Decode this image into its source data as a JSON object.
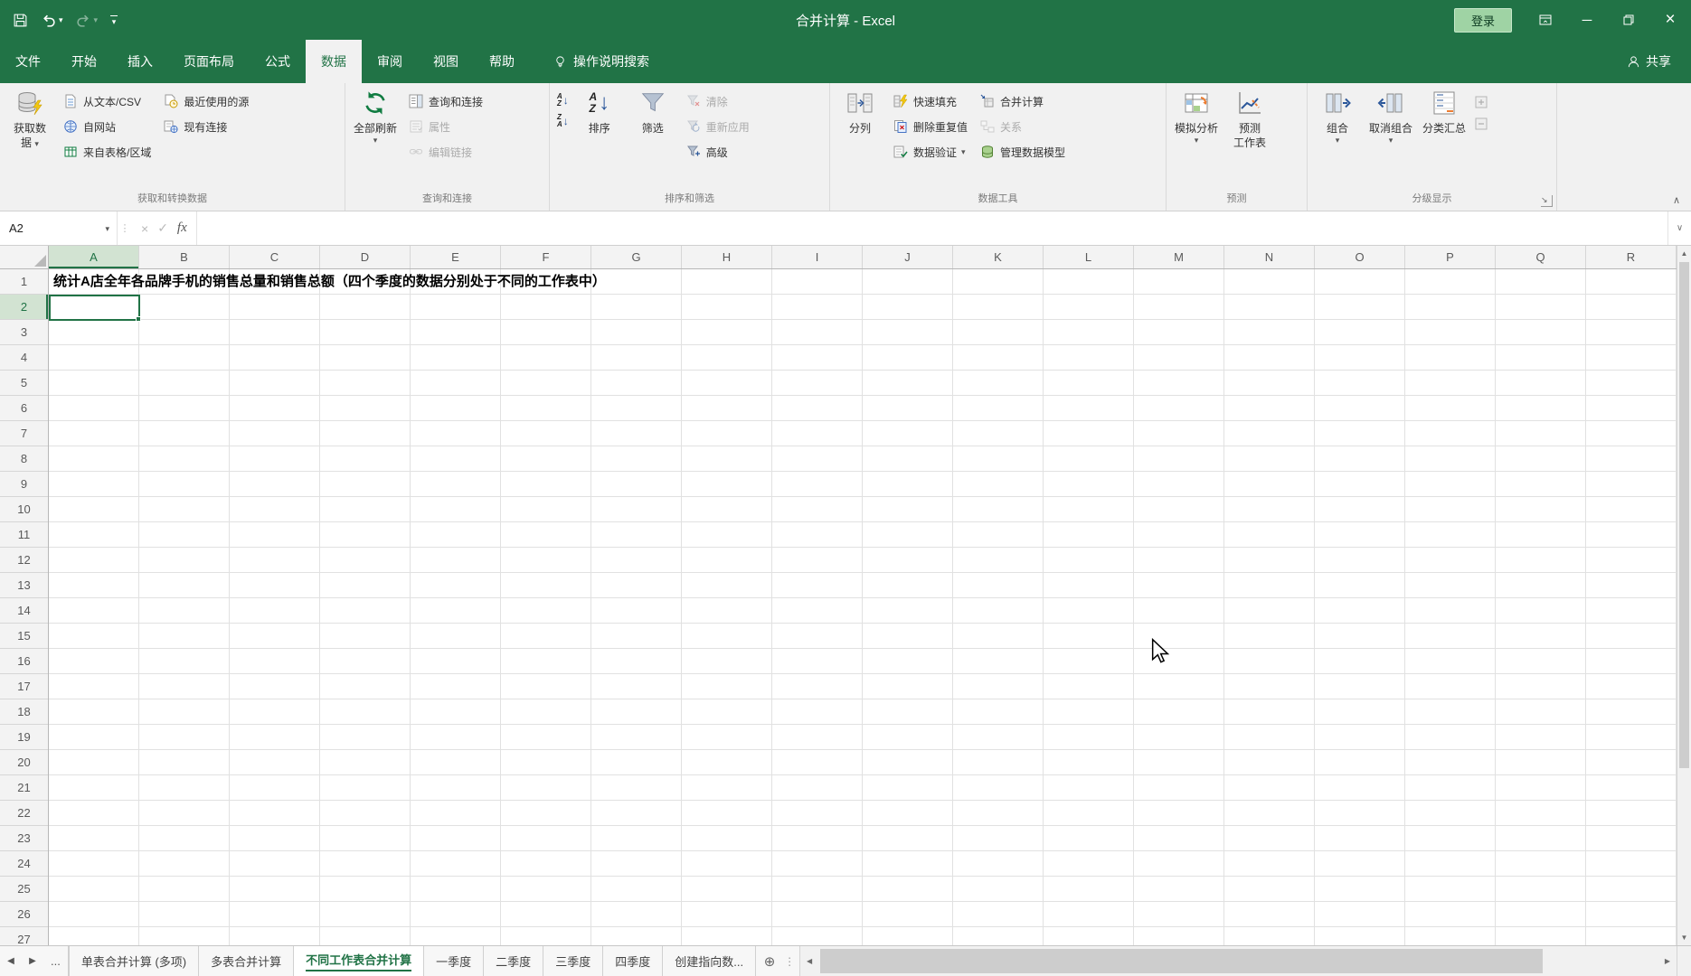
{
  "theme": {
    "titlebar_green": "#217346",
    "accent_green": "#217346",
    "ribbon_bg": "#f1f1f1",
    "header_bg": "#f3f3f3",
    "active_header_bg": "#d2e3d2",
    "grid_line": "#e1e1e1",
    "disabled_text": "#ababab",
    "signin_bg": "#9fd3a4"
  },
  "glyphs": {
    "dropdown": "▾",
    "collapse": "∧",
    "expand": "∨",
    "up": "▲",
    "down": "▼",
    "left": "◀",
    "right": "▶",
    "arrow_down": "↓",
    "letter_a": "A",
    "letter_z": "Z",
    "add_sheet": "⊕",
    "grip": "⋮",
    "ellipsis": "...",
    "cancel": "×",
    "check": "✓",
    "launcher": "↘",
    "minimize": "─",
    "close": "×",
    "plus": "+",
    "minus": "−"
  },
  "titlebar": {
    "title": "合并计算 - Excel",
    "signin": "登录"
  },
  "tabs": {
    "file": "文件",
    "items": [
      "开始",
      "插入",
      "页面布局",
      "公式",
      "数据",
      "审阅",
      "视图",
      "帮助"
    ],
    "active": "数据",
    "search": "操作说明搜索",
    "share": "共享"
  },
  "ribbon": {
    "groups": [
      {
        "label": "获取和转换数据",
        "get_data_lines": [
          "获取数",
          "据"
        ],
        "from_text_csv": "从文本/CSV",
        "from_web": "自网站",
        "from_table": "来自表格/区域",
        "recent_sources": "最近使用的源",
        "existing_connections": "现有连接"
      },
      {
        "label": "查询和连接",
        "refresh_all": "全部刷新",
        "queries_connections": "查询和连接",
        "properties": "属性",
        "edit_links": "编辑链接"
      },
      {
        "label": "排序和筛选",
        "sort": "排序",
        "filter": "筛选",
        "clear": "清除",
        "reapply": "重新应用",
        "advanced": "高级"
      },
      {
        "label": "数据工具",
        "text_to_columns": "分列",
        "flash_fill": "快速填充",
        "remove_duplicates": "删除重复值",
        "data_validation": "数据验证",
        "consolidate": "合并计算",
        "relationships": "关系",
        "manage_data_model": "管理数据模型"
      },
      {
        "label": "预测",
        "what_if": "模拟分析",
        "forecast_lines": [
          "预测",
          "工作表"
        ]
      },
      {
        "label": "分级显示",
        "group": "组合",
        "ungroup": "取消组合",
        "subtotal": "分类汇总"
      }
    ]
  },
  "formula_bar": {
    "name_box": "A2",
    "fx": "fx",
    "value": ""
  },
  "grid": {
    "columns": [
      "A",
      "B",
      "C",
      "D",
      "E",
      "F",
      "G",
      "H",
      "I",
      "J",
      "K",
      "L",
      "M",
      "N",
      "O",
      "P",
      "Q",
      "R"
    ],
    "visible_rows": 27,
    "active_cell": {
      "col": "A",
      "row": 2,
      "ref": "A2"
    },
    "cells": {
      "A1": "统计A店全年各品牌手机的销售总量和销售总额（四个季度的数据分别处于不同的工作表中）"
    }
  },
  "sheet_tabs": {
    "tabs": [
      "单表合并计算 (多项)",
      "多表合并计算",
      "不同工作表合并计算",
      "一季度",
      "二季度",
      "三季度",
      "四季度",
      "创建指向数..."
    ],
    "active": "不同工作表合并计算"
  }
}
